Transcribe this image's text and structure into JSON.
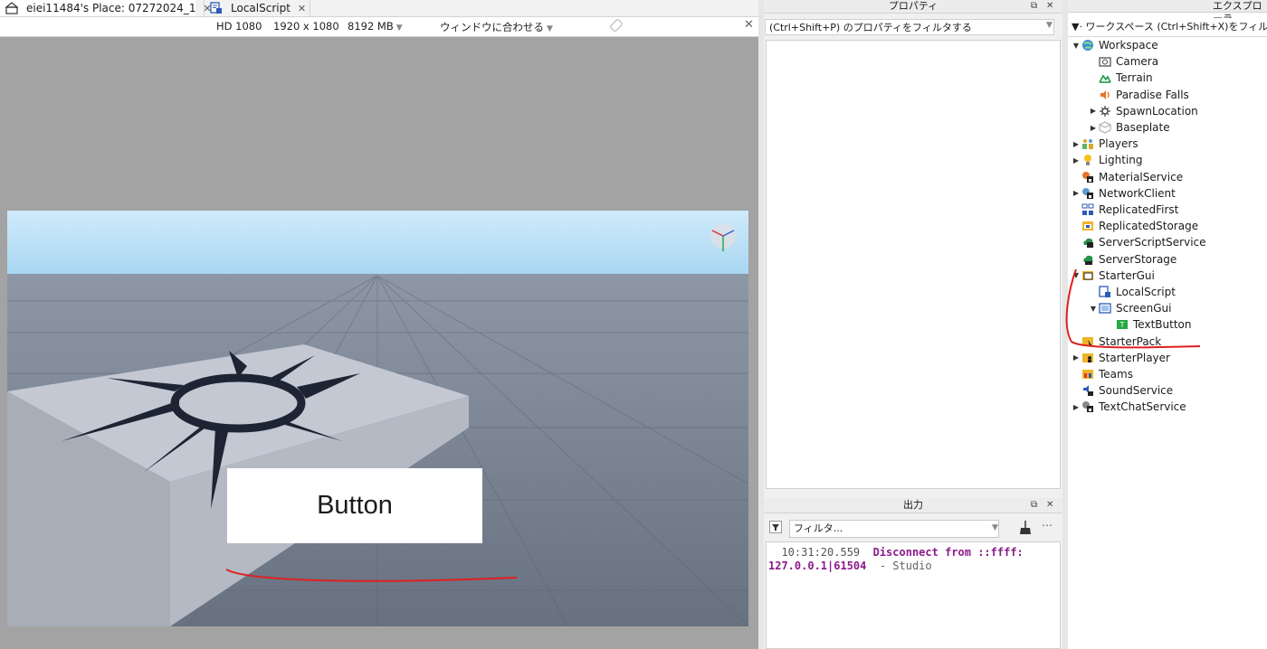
{
  "tabs": [
    {
      "label": "eiei11484's Place: 07272024_1",
      "icon": "place-icon",
      "active": true
    },
    {
      "label": "LocalScript",
      "icon": "localscript-icon",
      "active": false
    }
  ],
  "device_bar": {
    "preset": "HD 1080",
    "resolution": "1920 x 1080",
    "memory": "8192 MB",
    "fit": "ウィンドウに合わせる"
  },
  "viewport": {
    "gui_button_text": "Button",
    "annotation_color": "#e02020",
    "sky_color": "#bfe3f8",
    "ground_color": "#7d8696"
  },
  "properties": {
    "title": "プロパティ",
    "filter_placeholder": "(Ctrl+Shift+P) のプロパティをフィルタする"
  },
  "output": {
    "title": "出力",
    "filter_placeholder": "フィルタ...",
    "log": {
      "time": "10:31:20.559",
      "message": "Disconnect from ::ffff: 127.0.0.1|61504",
      "source": "- Studio"
    }
  },
  "explorer": {
    "title": "エクスプローラ",
    "filter_placeholder": "ワークスペース (Ctrl+Shift+X)をフィルタ",
    "items": [
      {
        "label": "Workspace",
        "icon": "workspace-icon",
        "depth": 0,
        "arrow": "expanded"
      },
      {
        "label": "Camera",
        "icon": "camera-icon",
        "depth": 1,
        "arrow": "none"
      },
      {
        "label": "Terrain",
        "icon": "terrain-icon",
        "depth": 1,
        "arrow": "none"
      },
      {
        "label": "Paradise Falls",
        "icon": "sound-icon",
        "depth": 1,
        "arrow": "none"
      },
      {
        "label": "SpawnLocation",
        "icon": "spawnlocation-icon",
        "depth": 1,
        "arrow": "collapsed"
      },
      {
        "label": "Baseplate",
        "icon": "part-icon",
        "depth": 1,
        "arrow": "collapsed"
      },
      {
        "label": "Players",
        "icon": "players-icon",
        "depth": 0,
        "arrow": "collapsed"
      },
      {
        "label": "Lighting",
        "icon": "lighting-icon",
        "depth": 0,
        "arrow": "collapsed"
      },
      {
        "label": "MaterialService",
        "icon": "materialservice-icon",
        "depth": 0,
        "arrow": "none"
      },
      {
        "label": "NetworkClient",
        "icon": "networkclient-icon",
        "depth": 0,
        "arrow": "collapsed"
      },
      {
        "label": "ReplicatedFirst",
        "icon": "replicatedfirst-icon",
        "depth": 0,
        "arrow": "none"
      },
      {
        "label": "ReplicatedStorage",
        "icon": "replicatedstorage-icon",
        "depth": 0,
        "arrow": "none"
      },
      {
        "label": "ServerScriptService",
        "icon": "serverscriptservice-icon",
        "depth": 0,
        "arrow": "none"
      },
      {
        "label": "ServerStorage",
        "icon": "serverstorage-icon",
        "depth": 0,
        "arrow": "none"
      },
      {
        "label": "StarterGui",
        "icon": "startergui-icon",
        "depth": 0,
        "arrow": "expanded"
      },
      {
        "label": "LocalScript",
        "icon": "localscript-icon",
        "depth": 1,
        "arrow": "none"
      },
      {
        "label": "ScreenGui",
        "icon": "screengui-icon",
        "depth": 1,
        "arrow": "expanded"
      },
      {
        "label": "TextButton",
        "icon": "textbutton-icon",
        "depth": 2,
        "arrow": "none"
      },
      {
        "label": "StarterPack",
        "icon": "starterpack-icon",
        "depth": 0,
        "arrow": "none"
      },
      {
        "label": "StarterPlayer",
        "icon": "starterplayer-icon",
        "depth": 0,
        "arrow": "collapsed"
      },
      {
        "label": "Teams",
        "icon": "teams-icon",
        "depth": 0,
        "arrow": "none"
      },
      {
        "label": "SoundService",
        "icon": "soundservice-icon",
        "depth": 0,
        "arrow": "none"
      },
      {
        "label": "TextChatService",
        "icon": "textchatservice-icon",
        "depth": 0,
        "arrow": "collapsed"
      }
    ]
  }
}
